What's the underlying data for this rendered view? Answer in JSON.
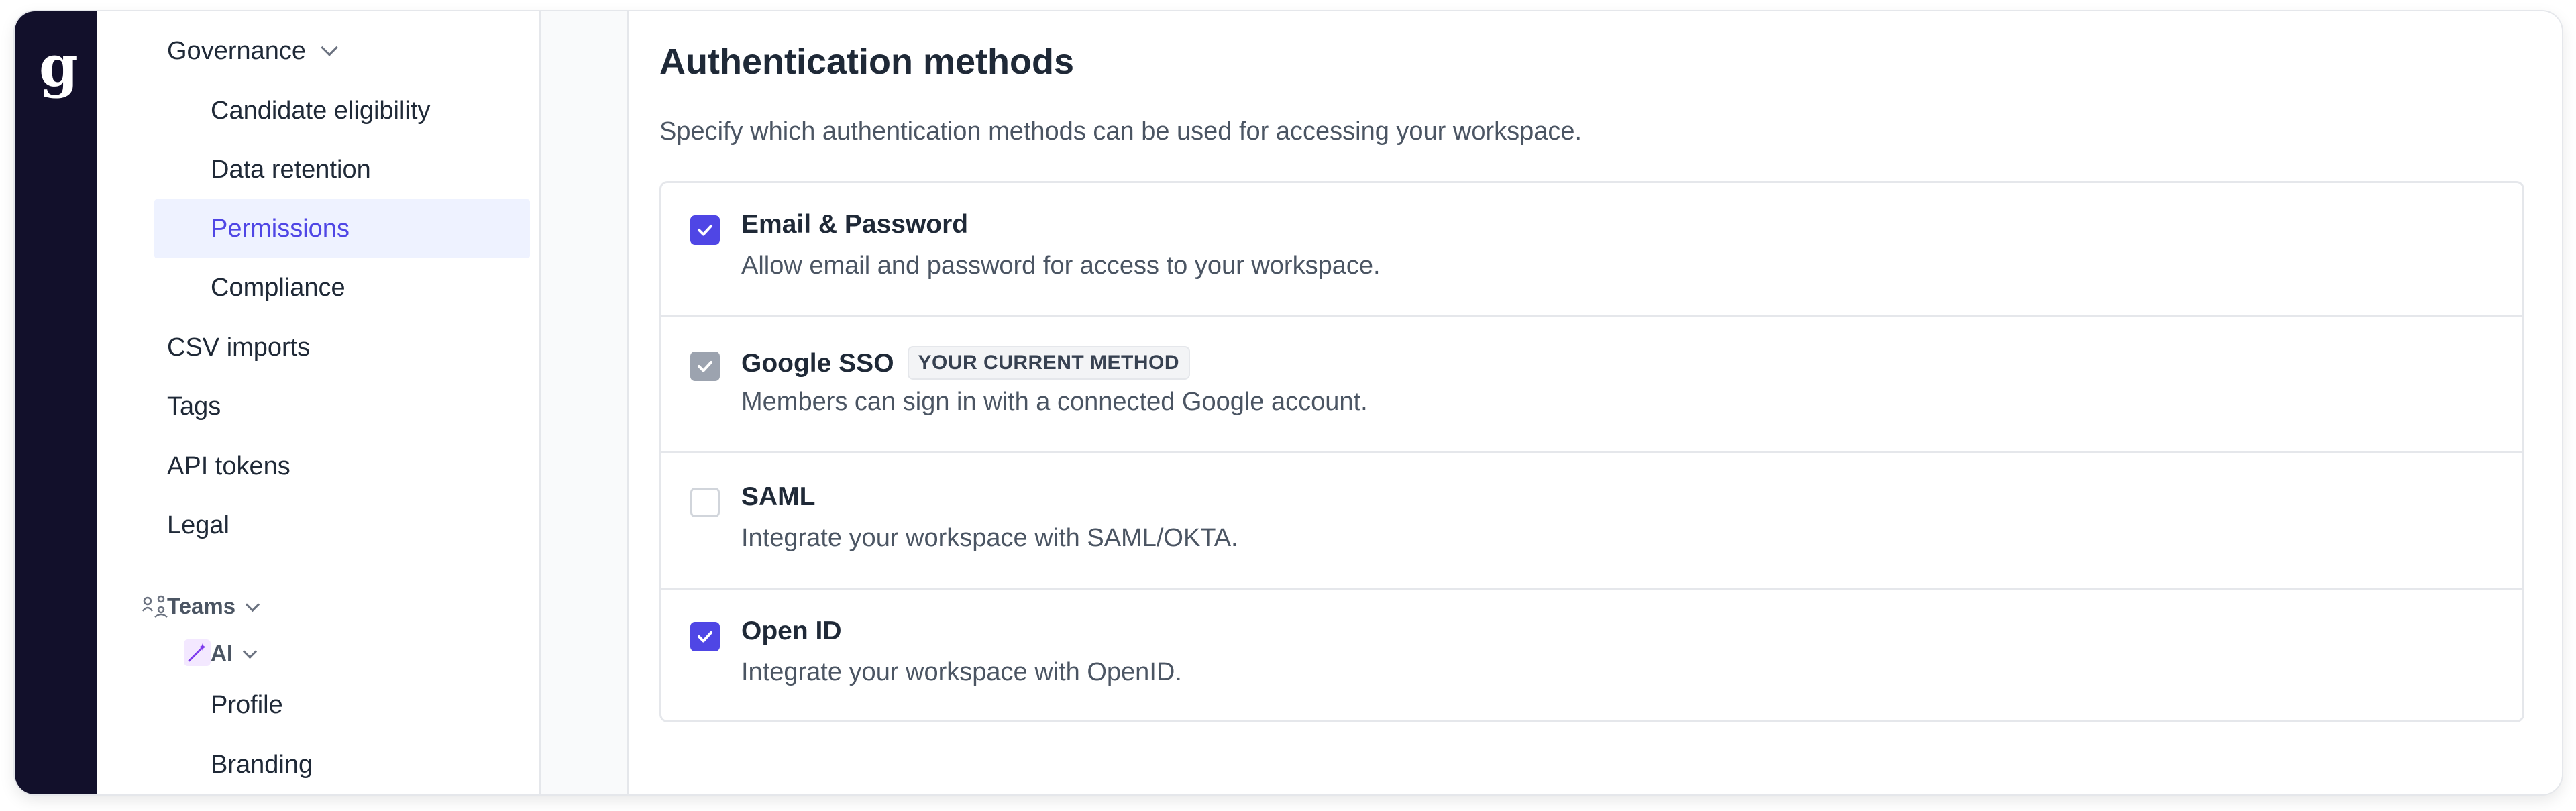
{
  "app": {
    "logo_letter": "g"
  },
  "sidebar": {
    "governance": {
      "label": "Governance"
    },
    "governance_items": [
      {
        "label": "Candidate eligibility"
      },
      {
        "label": "Data retention"
      },
      {
        "label": "Permissions",
        "active": true
      },
      {
        "label": "Compliance"
      }
    ],
    "top_items": [
      {
        "label": "CSV imports"
      },
      {
        "label": "Tags"
      },
      {
        "label": "API tokens"
      },
      {
        "label": "Legal"
      }
    ],
    "teams": {
      "label": "Teams",
      "icon": "teams-icon"
    },
    "ai": {
      "label": "AI",
      "icon": "magic-wand-icon"
    },
    "ai_items": [
      {
        "label": "Profile"
      },
      {
        "label": "Branding"
      }
    ]
  },
  "main": {
    "title": "Authentication methods",
    "description": "Specify which authentication methods can be used for accessing your workspace.",
    "methods": [
      {
        "title": "Email & Password",
        "description": "Allow email and password for access to your workspace.",
        "checked": true,
        "disabled": false,
        "badge": ""
      },
      {
        "title": "Google SSO",
        "description": "Members can sign in with a connected Google account.",
        "checked": true,
        "disabled": true,
        "badge": "YOUR CURRENT METHOD"
      },
      {
        "title": "SAML",
        "description": "Integrate your workspace with SAML/OKTA.",
        "checked": false,
        "disabled": false,
        "badge": ""
      },
      {
        "title": "Open ID",
        "description": "Integrate your workspace with OpenID.",
        "checked": true,
        "disabled": false,
        "badge": ""
      }
    ]
  },
  "colors": {
    "accent": "#4f46e5",
    "rail": "#12102b",
    "active_bg": "#eef2ff",
    "disabled_check": "#9ca3af"
  }
}
